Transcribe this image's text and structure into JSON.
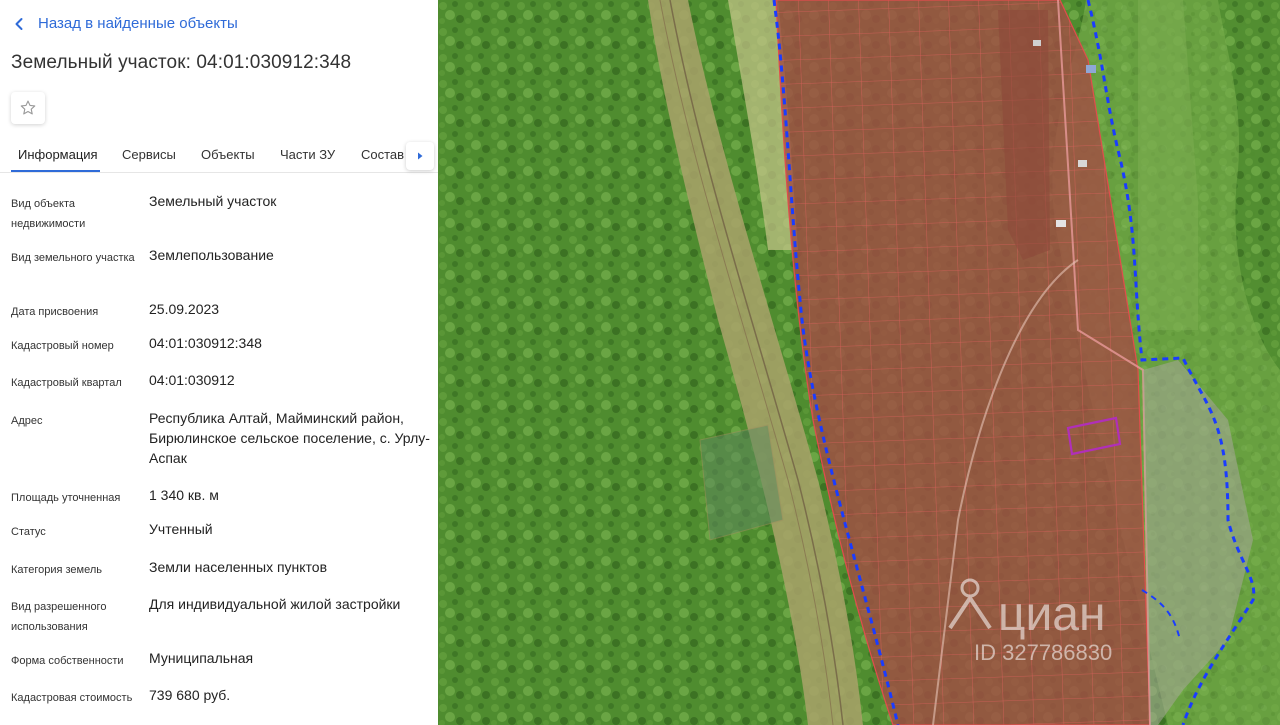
{
  "nav": {
    "back_label": "Назад в найденные объекты"
  },
  "header": {
    "title": "Земельный участок: 04:01:030912:348"
  },
  "tabs": [
    {
      "label": "Информация",
      "active": true
    },
    {
      "label": "Сервисы",
      "active": false
    },
    {
      "label": "Объекты",
      "active": false
    },
    {
      "label": "Части ЗУ",
      "active": false
    },
    {
      "label": "Состав",
      "active": false
    }
  ],
  "info": {
    "object_type": {
      "label": "Вид объекта недвижимости",
      "value": "Земельный участок"
    },
    "land_type": {
      "label": "Вид земельного участка",
      "value": "Землепользование"
    },
    "assigned_date": {
      "label": "Дата присвоения",
      "value": "25.09.2023"
    },
    "cadastral_number": {
      "label": "Кадастровый номер",
      "value": "04:01:030912:348"
    },
    "cadastral_quarter": {
      "label": "Кадастровый квартал",
      "value": "04:01:030912"
    },
    "address": {
      "label": "Адрес",
      "value": "Республика Алтай, Майминский район, Бирюлинское сельское поселение, с. Урлу-Аспак"
    },
    "area": {
      "label": "Площадь уточненная",
      "value": "1 340 кв. м"
    },
    "status": {
      "label": "Статус",
      "value": "Учтенный"
    },
    "land_category": {
      "label": "Категория земель",
      "value": "Земли населенных пунктов"
    },
    "permitted_use": {
      "label": "Вид разрешенного использования",
      "value": "Для индивидуальной жилой застройки"
    },
    "ownership": {
      "label": "Форма собственности",
      "value": "Муниципальная"
    },
    "cadastral_value": {
      "label": "Кадастровая стоимость",
      "value": "739 680 руб."
    }
  },
  "map": {
    "watermark_brand": "циан",
    "watermark_id": "ID 327786830"
  },
  "colors": {
    "accent": "#2f6bd8",
    "parcel_fill": "#a4493f",
    "parcel_border": "#e24c4c",
    "boundary_dash": "#1a3cff",
    "selected_parcel": "#b02fb8",
    "forest": "#4d8a2e"
  },
  "icons": [
    "chevron-left-icon",
    "star-icon",
    "chevron-right-icon"
  ]
}
